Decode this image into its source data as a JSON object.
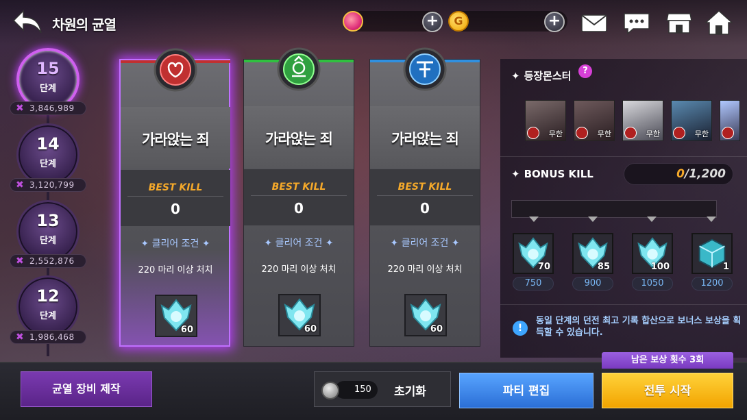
{
  "header": {
    "title": "차원의 균열",
    "currency": [
      {
        "icon": "gem-currency-icon"
      },
      {
        "icon": "gold-currency-icon",
        "symbol": "G"
      }
    ],
    "plus": "+"
  },
  "stages": [
    {
      "num": "15",
      "unit": "단계",
      "score": "3,846,989",
      "active": true
    },
    {
      "num": "14",
      "unit": "단계",
      "score": "3,120,799",
      "active": false
    },
    {
      "num": "13",
      "unit": "단계",
      "score": "2,552,876",
      "active": false
    },
    {
      "num": "12",
      "unit": "단계",
      "score": "1,986,468",
      "active": false
    }
  ],
  "score_marker": "✖",
  "cards": [
    {
      "name": "가라앉는 죄",
      "best_label": "BEST KILL",
      "best_value": "0",
      "cond_title": "✦ 클리어 조건 ✦",
      "cond_text": "220 마리 이상 처치",
      "reward_count": "60",
      "color": "#c03030"
    },
    {
      "name": "가라앉는 죄",
      "best_label": "BEST KILL",
      "best_value": "0",
      "cond_title": "✦ 클리어 조건 ✦",
      "cond_text": "220 마리 이상 처치",
      "reward_count": "60",
      "color": "#30c040"
    },
    {
      "name": "가라앉는 죄",
      "best_label": "BEST KILL",
      "best_value": "0",
      "cond_title": "✦ 클리어 조건 ✦",
      "cond_text": "220 마리 이상 처치",
      "reward_count": "60",
      "color": "#3090e0"
    }
  ],
  "panel": {
    "monsters_title": "등장몬스터",
    "help": "?",
    "monsters": [
      {
        "label": "무한"
      },
      {
        "label": "무한"
      },
      {
        "label": "무한"
      },
      {
        "label": "무한"
      },
      {
        "label": ""
      }
    ],
    "bonus_title": "BONUS KILL",
    "bonus_current": "0",
    "bonus_total": "/1,200",
    "bonus_rewards": [
      {
        "count": "70",
        "threshold": "750"
      },
      {
        "count": "85",
        "threshold": "900"
      },
      {
        "count": "100",
        "threshold": "1050"
      },
      {
        "count": "1",
        "threshold": "1200"
      }
    ],
    "info_icon": "!",
    "info_text": "동일 단계의 던전 최고 기록 합산으로 보너스 보상을 획득할 수 있습니다."
  },
  "bottom": {
    "craft": "균열 장비 제작",
    "reset_cost": "150",
    "reset_label": "초기화",
    "party": "파티 편집",
    "start": "전투 시작",
    "remaining": "남은 보상 횟수 3회"
  }
}
